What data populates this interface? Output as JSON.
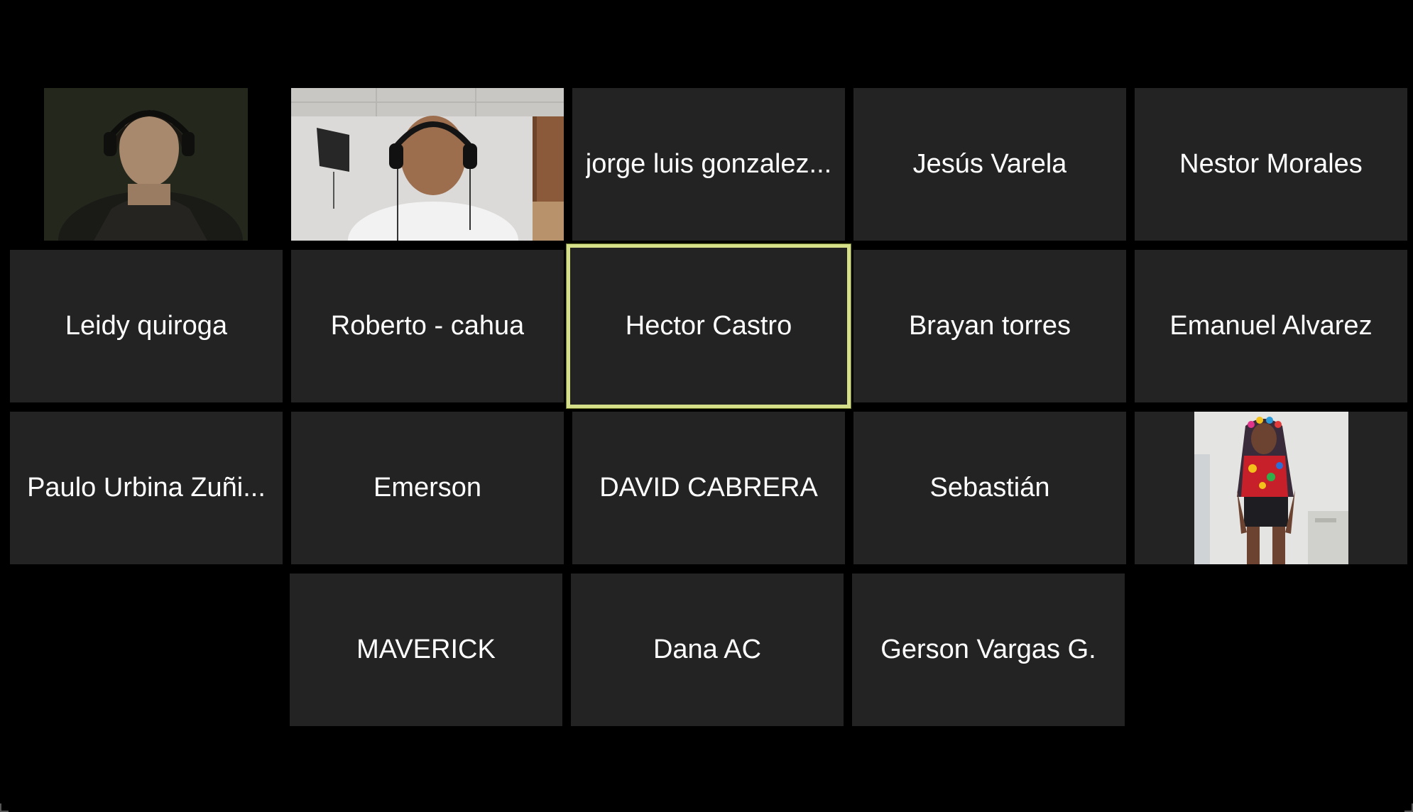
{
  "meeting": {
    "view": "gallery",
    "participants": [
      {
        "id": "p1",
        "name": "",
        "has_video": true,
        "feed": "girl-with-headphones"
      },
      {
        "id": "p2",
        "name": "",
        "has_video": true,
        "feed": "man-with-headphones"
      },
      {
        "id": "p3",
        "name": "jorge luis gonzalez...",
        "has_video": false
      },
      {
        "id": "p4",
        "name": "Jesús Varela",
        "has_video": false
      },
      {
        "id": "p5",
        "name": "Nestor Morales",
        "has_video": false
      },
      {
        "id": "p6",
        "name": "Leidy quiroga",
        "has_video": false
      },
      {
        "id": "p7",
        "name": "Roberto - cahua",
        "has_video": false
      },
      {
        "id": "p8",
        "name": "Hector Castro",
        "has_video": false,
        "active_speaker": true
      },
      {
        "id": "p9",
        "name": "Brayan torres",
        "has_video": false
      },
      {
        "id": "p10",
        "name": "Emanuel Alvarez",
        "has_video": false
      },
      {
        "id": "p11",
        "name": "Paulo Urbina Zuñi...",
        "has_video": false
      },
      {
        "id": "p12",
        "name": "Emerson",
        "has_video": false
      },
      {
        "id": "p13",
        "name": "DAVID CABRERA",
        "has_video": false
      },
      {
        "id": "p14",
        "name": "Sebastián",
        "has_video": false
      },
      {
        "id": "p15",
        "name": "",
        "has_video": true,
        "feed": "woman-in-colorful-top"
      },
      {
        "id": "p16",
        "name": "MAVERICK",
        "has_video": false
      },
      {
        "id": "p17",
        "name": "Dana AC",
        "has_video": false
      },
      {
        "id": "p18",
        "name": "Gerson Vargas G.",
        "has_video": false
      }
    ]
  },
  "colors": {
    "background": "#000000",
    "tile": "#232323",
    "active_border": "#d6e08a",
    "name_text": "#ffffff"
  }
}
